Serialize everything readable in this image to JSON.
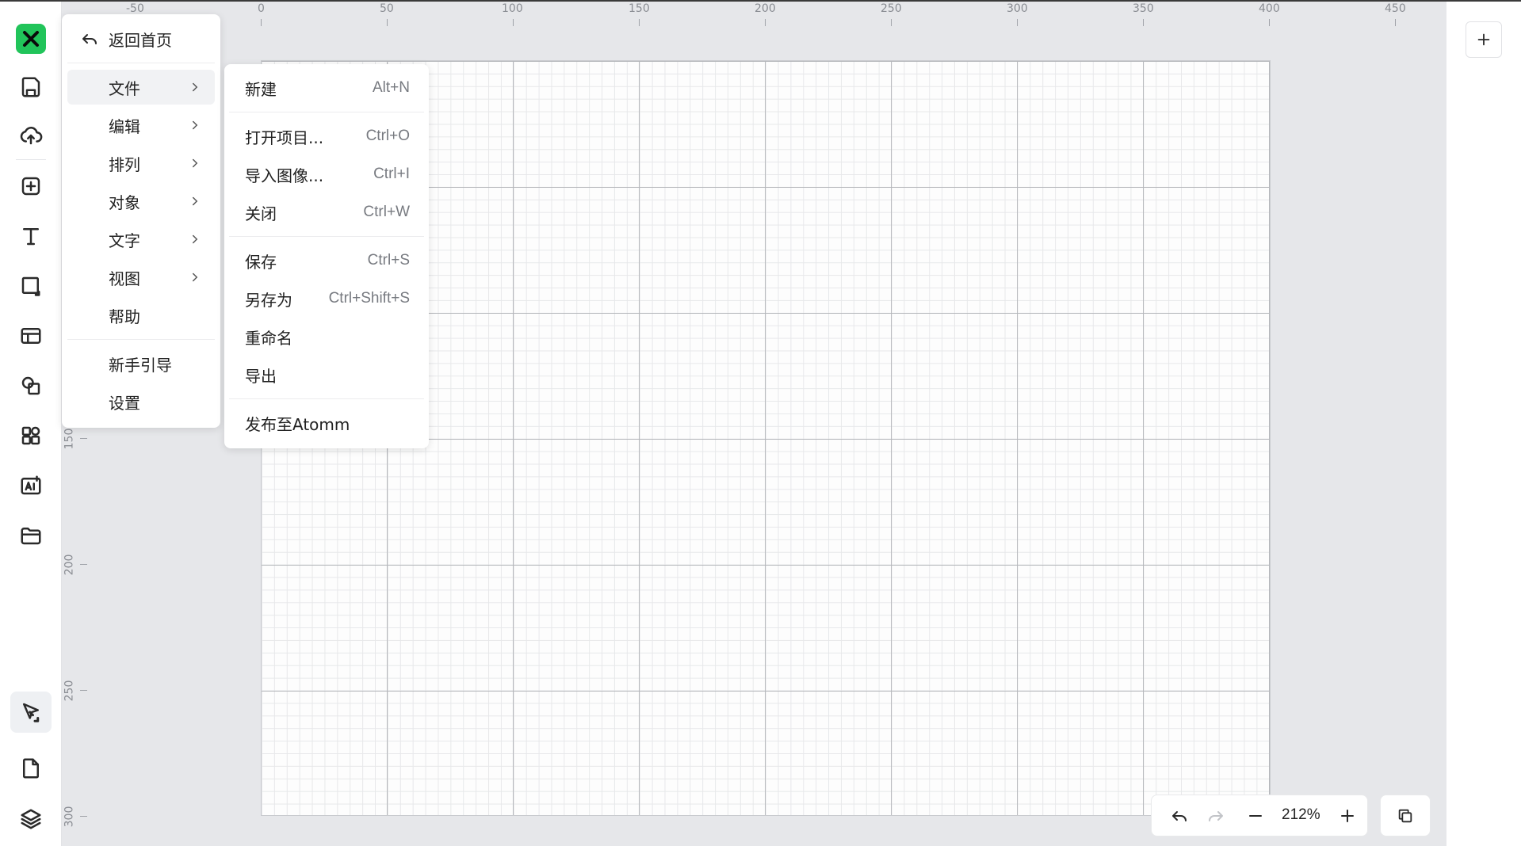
{
  "menu": {
    "back_label": "返回首页",
    "items": [
      {
        "label": "文件",
        "has_submenu": true,
        "selected": true
      },
      {
        "label": "编辑",
        "has_submenu": true
      },
      {
        "label": "排列",
        "has_submenu": true
      },
      {
        "label": "对象",
        "has_submenu": true
      },
      {
        "label": "文字",
        "has_submenu": true
      },
      {
        "label": "视图",
        "has_submenu": true
      },
      {
        "label": "帮助",
        "has_submenu": false
      }
    ],
    "extra_items": [
      {
        "label": "新手引导"
      },
      {
        "label": "设置"
      }
    ]
  },
  "file_submenu": {
    "items": [
      {
        "label": "新建",
        "shortcut": "Alt+N"
      },
      {
        "label": "打开项目...",
        "shortcut": "Ctrl+O"
      },
      {
        "label": "导入图像...",
        "shortcut": "Ctrl+I"
      },
      {
        "label": "关闭",
        "shortcut": "Ctrl+W"
      },
      {
        "label": "保存",
        "shortcut": "Ctrl+S"
      },
      {
        "label": "另存为",
        "shortcut": "Ctrl+Shift+S"
      },
      {
        "label": "重命名",
        "shortcut": ""
      },
      {
        "label": "导出",
        "shortcut": ""
      },
      {
        "label": "发布至Atomm",
        "shortcut": ""
      }
    ]
  },
  "ruler": {
    "top_labels": [
      "-50",
      "0",
      "50",
      "100",
      "150",
      "200",
      "250",
      "300",
      "350",
      "400",
      "450"
    ],
    "left_labels": [
      "150",
      "200",
      "250",
      "300"
    ]
  },
  "toolbar": {
    "tools": [
      "logo",
      "save-icon",
      "cloud-upload-icon",
      "add-box-icon",
      "text-icon",
      "shape-icon",
      "layout-icon",
      "shapes-icon",
      "elements-icon",
      "ai-icon",
      "folder-icon",
      "pen-tool-icon",
      "page-icon",
      "layers-icon"
    ],
    "brand_color": "#21c45a"
  },
  "zoom": {
    "level": "212%"
  }
}
